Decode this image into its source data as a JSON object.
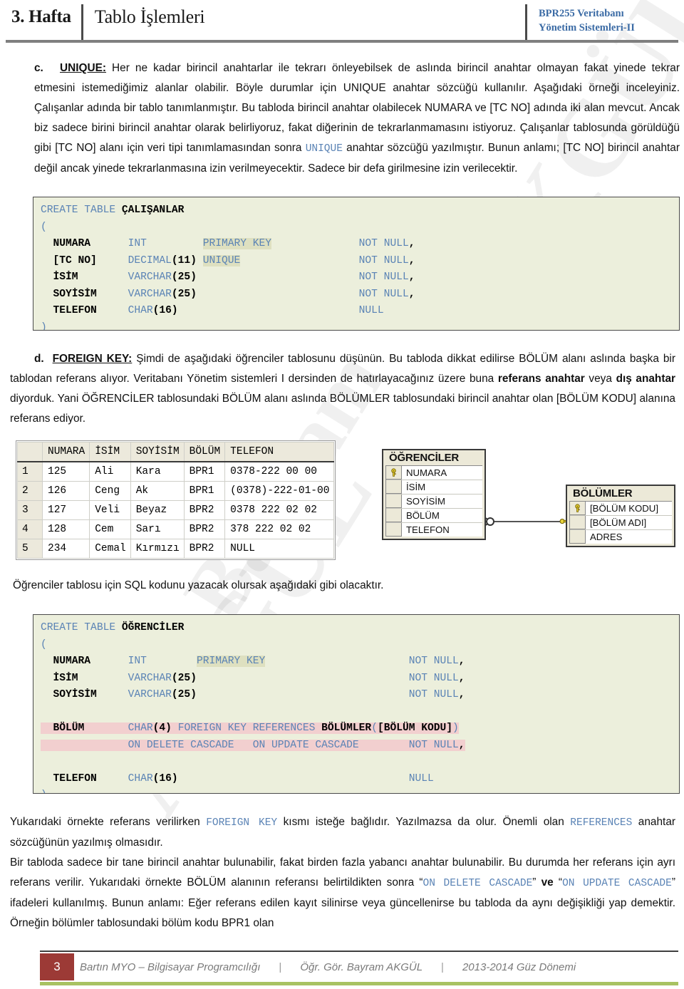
{
  "header": {
    "week": "3. Hafta",
    "title": "Tablo İşlemleri",
    "course_line1": "BPR255 Veritabanı",
    "course_line2": "Yönetim Sistemleri-II",
    "accent_color": "#3b6ba5"
  },
  "watermark": {
    "text_a": "AKGÜL",
    "text_b": "AKGÜL",
    "text_c": "Bayram"
  },
  "paragraphs": {
    "c_marker": "c.",
    "c_label": "UNIQUE:",
    "c_part1": " Her ne kadar birincil anahtarlar ile tekrarı önleyebilsek de aslında birincil anahtar olmayan fakat yinede tekrar etmesini istemediğimiz alanlar olabilir. Böyle durumlar için UNIQUE anahtar sözcüğü kullanılır. Aşağıdaki örneği inceleyiniz. Çalışanlar adında bir tablo tanımlanmıştır. Bu tabloda birincil anahtar olabilecek NUMARA ve [TC NO] adında iki alan mevcut. Ancak biz sadece birini birincil anahtar olarak belirliyoruz, fakat diğerinin de tekrarlanmamasını istiyoruz. Çalışanlar tablosunda görüldüğü gibi [TC NO] alanı için veri tipi tanımlamasından sonra ",
    "c_code1": "UNIQUE",
    "c_part2": " anahtar sözcüğü yazılmıştır. Bunun anlamı; [TC NO] birincil anahtar değil ancak yinede tekrarlanmasına izin verilmeyecektir. Sadece bir defa girilmesine izin verilecektir.",
    "d_marker": "d.",
    "d_label": "FOREIGN KEY:",
    "d_part1": " Şimdi de aşağıdaki öğrenciler tablosunu düşünün.  Bu tabloda dikkat edilirse BÖLÜM alanı aslında başka bir tablodan referans alıyor. Veritabanı Yönetim sistemleri I dersinden de hatırlayacağınız üzere buna ",
    "d_bold1": "referans anahtar",
    "d_part2": " veya ",
    "d_bold2": "dış anahtar",
    "d_part3": " diyorduk.  Yani ÖĞRENCİLER tablosundaki BÖLÜM alanı aslında BÖLÜMLER tablosundaki birincil anahtar olan [BÖLÜM KODU] alanına referans ediyor.",
    "intro_sql": "Öğrenciler tablosu için SQL kodunu yazacak olursak aşağıdaki gibi olacaktır.",
    "bot_l1_a": "Yukarıdaki örnekte referans verilirken ",
    "bot_l1_code": "FOREIGN KEY",
    "bot_l1_b": " kısmı isteğe bağlıdır. Yazılmazsa da olur. Önemli olan ",
    "bot_l2_code": "REFERENCES",
    "bot_l2_b": " anahtar sözcüğünün yazılmış olmasıdır.",
    "bot_l3_a": "Bir tabloda sadece bir tane birincil anahtar bulunabilir, fakat birden fazla yabancı anahtar bulunabilir.  Bu durumda her referans için ayrı referans verilir. Yukarıdaki örnekte BÖLÜM alanının referansı belirtildikten sonra “",
    "bot_l3_code1": "ON DELETE CASCADE",
    "bot_l3_b": "” ",
    "bot_l3_bold": "ve",
    "bot_l3_c": "  “",
    "bot_l3_code2": "ON UPDATE CASCADE",
    "bot_l3_d": "” ifadeleri kullanılmış. Bunun anlamı: Eğer referans edilen kayıt silinirse veya güncellenirse bu tabloda da aynı değişikliği yap demektir. Örneğin bölümler tablosundaki bölüm kodu BPR1 olan"
  },
  "code_calisanlar": {
    "lines": [
      "CREATE TABLE ÇALIŞANLAR",
      "(",
      "  NUMARA      INT         PRIMARY KEY              NOT NULL,",
      "  [TC NO]     DECIMAL(11) UNIQUE                   NOT NULL,",
      "  İSİM        VARCHAR(25)                          NOT NULL,",
      "  SOYİSİM     VARCHAR(25)                          NOT NULL,",
      "  TELEFON     CHAR(16)                             NULL",
      ")"
    ],
    "bg_color": "#ecefdc",
    "highlight_color": "#dee0c0",
    "keyword_color": "#5a83b5"
  },
  "code_ogrenciler": {
    "lines": [
      "CREATE TABLE ÖĞRENCİLER",
      "(",
      "  NUMARA      INT        PRIMARY KEY                       NOT NULL,",
      "  İSİM        VARCHAR(25)                                  NOT NULL,",
      "  SOYİSİM     VARCHAR(25)                                  NOT NULL,",
      "",
      "  BÖLÜM       CHAR(4) FOREIGN KEY REFERENCES BÖLÜMLER([BÖLÜM KODU])",
      "              ON DELETE CASCADE   ON UPDATE CASCADE        NOT NULL,",
      "",
      "  TELEFON     CHAR(16)                                     NULL",
      ")"
    ],
    "bg_color": "#ecefdc",
    "highlight_color": "#f2cfcf",
    "keyword_color": "#5a83b5"
  },
  "data_grid": {
    "columns": [
      "",
      "NUMARA",
      "İSİM",
      "SOYİSİM",
      "BÖLÜM",
      "TELEFON"
    ],
    "rows": [
      [
        "1",
        "125",
        "Ali",
        "Kara",
        "BPR1",
        "0378-222 00 00"
      ],
      [
        "2",
        "126",
        "Ceng",
        "Ak",
        "BPR1",
        "(0378)-222-01-00"
      ],
      [
        "3",
        "127",
        "Veli",
        "Beyaz",
        "BPR2",
        "0378 222 02 02"
      ],
      [
        "4",
        "128",
        "Cem",
        "Sarı",
        "BPR2",
        "378 222 02 02"
      ],
      [
        "5",
        "234",
        "Cemal",
        "Kırmızı",
        "BPR2",
        "NULL"
      ]
    ]
  },
  "er_diagram": {
    "tables": [
      {
        "name": "ÖĞRENCİLER",
        "fields": [
          {
            "name": "NUMARA",
            "key": true
          },
          {
            "name": "İSİM",
            "key": false
          },
          {
            "name": "SOYİSİM",
            "key": false
          },
          {
            "name": "BÖLÜM",
            "key": false
          },
          {
            "name": "TELEFON",
            "key": false
          }
        ]
      },
      {
        "name": "BÖLÜMLER",
        "fields": [
          {
            "name": "[BÖLÜM KODU]",
            "key": true
          },
          {
            "name": "[BÖLÜM ADI]",
            "key": false
          },
          {
            "name": "ADRES",
            "key": false
          }
        ]
      }
    ],
    "relation": "one-to-many",
    "key_color": "#e8d33a"
  },
  "footer": {
    "page_number": "3",
    "institution": "Bartın MYO – Bilgisayar Programcılığı",
    "instructor": "Öğr. Gör. Bayram AKGÜL",
    "term": "2013-2014 Güz Dönemi",
    "separator": "|",
    "page_box_color": "#9c3a36",
    "rule_color": "#a8c262"
  }
}
